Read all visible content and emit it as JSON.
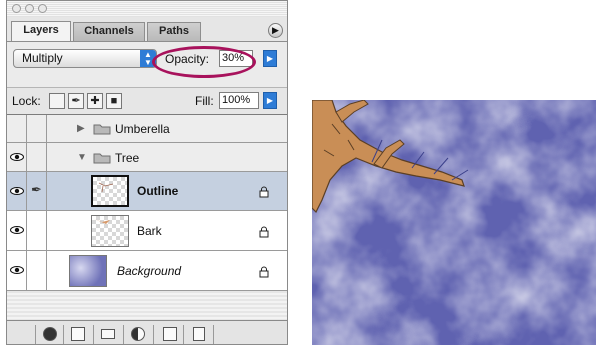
{
  "panel_tabs": [
    {
      "label": "Layers",
      "active": true
    },
    {
      "label": "Channels",
      "active": false
    },
    {
      "label": "Paths",
      "active": false
    }
  ],
  "blend_mode": "Multiply",
  "opacity": {
    "label": "Opacity:",
    "value": "30%"
  },
  "lock": {
    "label": "Lock:"
  },
  "fill": {
    "label": "Fill:",
    "value": "100%"
  },
  "layers": [
    {
      "name": "Umberella",
      "kind": "group",
      "expanded": false,
      "visible": false,
      "selected": false
    },
    {
      "name": "Tree",
      "kind": "group",
      "expanded": true,
      "visible": true,
      "selected": false
    },
    {
      "name": "Outline",
      "kind": "layer",
      "visible": true,
      "selected": true,
      "locked": true,
      "bold": true
    },
    {
      "name": "Bark",
      "kind": "layer",
      "visible": true,
      "selected": false,
      "locked": true
    },
    {
      "name": "Background",
      "kind": "layer",
      "visible": true,
      "selected": false,
      "locked": true,
      "italic": true
    }
  ],
  "colors": {
    "highlight_oval": "#a8125c",
    "selection": "#c5d0e0",
    "accent_blue": "#2e7cd6"
  }
}
